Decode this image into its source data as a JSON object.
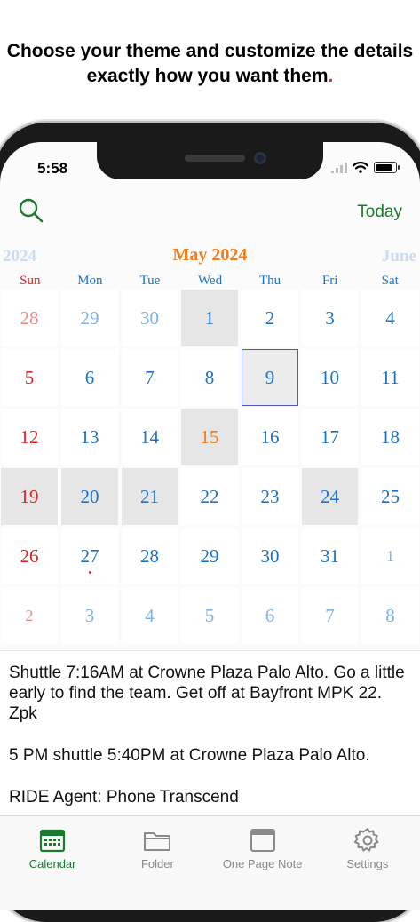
{
  "headline": {
    "text": "Choose your theme and customize the details exactly how you want them",
    "dot": "."
  },
  "status": {
    "time": "5:58"
  },
  "topbar": {
    "search_icon": "search-icon",
    "today_label": "Today"
  },
  "calendar": {
    "prev_label": "2024",
    "current_label": "May 2024",
    "next_label": "June",
    "weekdays": [
      "Sun",
      "Mon",
      "Tue",
      "Wed",
      "Thu",
      "Fri",
      "Sat"
    ],
    "weeks": [
      [
        "28",
        "29",
        "30",
        "1",
        "2",
        "3",
        "4"
      ],
      [
        "5",
        "6",
        "7",
        "8",
        "9",
        "10",
        "11"
      ],
      [
        "12",
        "13",
        "14",
        "15",
        "16",
        "17",
        "18"
      ],
      [
        "19",
        "20",
        "21",
        "22",
        "23",
        "24",
        "25"
      ],
      [
        "26",
        "27",
        "28",
        "29",
        "30",
        "31",
        "1"
      ],
      [
        "2",
        "3",
        "4",
        "5",
        "6",
        "7",
        "8"
      ]
    ],
    "selected_day": "9"
  },
  "notes": {
    "lines": [
      "Shuttle 7:16AM at Crowne Plaza Palo Alto. Go a little early to find the team. Get off at Bayfront MPK 22. Zpk",
      "5 PM shuttle 5:40PM at Crowne Plaza Palo Alto.",
      "RIDE Agent: Phone Transcend"
    ]
  },
  "tabs": [
    {
      "label": "Calendar",
      "icon": "calendar-icon",
      "active": true
    },
    {
      "label": "Folder",
      "icon": "folder-icon",
      "active": false
    },
    {
      "label": "One Page Note",
      "icon": "note-window-icon",
      "active": false
    },
    {
      "label": "Settings",
      "icon": "gear-icon",
      "active": false
    }
  ],
  "colors": {
    "accent_green": "#1b7a2e",
    "weekday_blue": "#1a73c9",
    "sunday_red": "#e02424",
    "month_orange": "#f07c1d",
    "adjacent_month": "#c9dcf4"
  }
}
